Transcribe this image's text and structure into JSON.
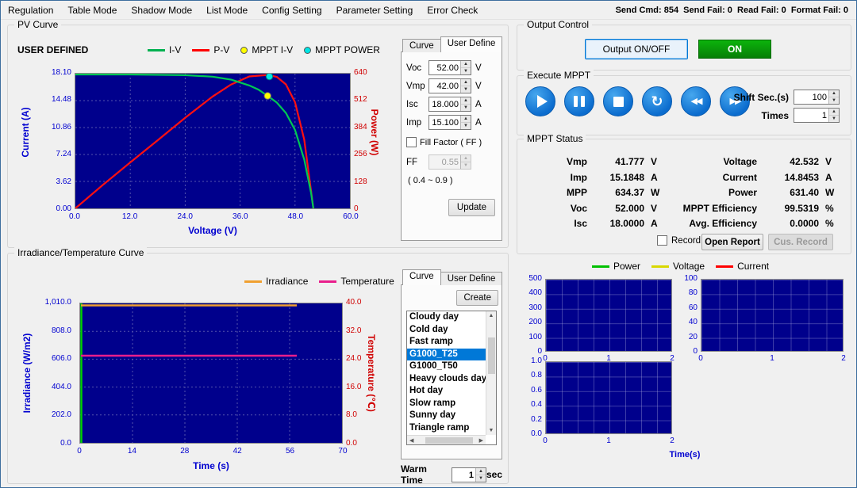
{
  "window": {
    "menu_items": [
      "Regulation",
      "Table Mode",
      "Shadow Mode",
      "List Mode",
      "Config Setting",
      "Parameter Setting",
      "Error Check"
    ],
    "comm_status": "Send Cmd: 854  Send Fail: 0  Read Fail: 0  Format Fail: 0"
  },
  "pv_curve": {
    "title": "PV Curve",
    "mode_label": "USER DEFINED",
    "legend": [
      {
        "label": "I-V",
        "color": "#00b050",
        "marker": "line"
      },
      {
        "label": "P-V",
        "color": "#ff0000",
        "marker": "line"
      },
      {
        "label": "MPPT I-V",
        "color": "#ffff00",
        "marker": "dot"
      },
      {
        "label": "MPPT POWER",
        "color": "#00e5e5",
        "marker": "dot"
      }
    ],
    "y_left": {
      "label": "Current (A)",
      "ticks": [
        "18.10",
        "14.48",
        "10.86",
        "7.24",
        "3.62",
        "0.00"
      ]
    },
    "y_right": {
      "label": "Power (W)",
      "ticks": [
        "640",
        "512",
        "384",
        "256",
        "128",
        "0"
      ]
    },
    "x": {
      "label": "Voltage (V)",
      "ticks": [
        "0.0",
        "12.0",
        "24.0",
        "36.0",
        "48.0",
        "60.0"
      ]
    }
  },
  "pv_params": {
    "tabs": [
      "Curve",
      "User Define"
    ],
    "fields": [
      {
        "label": "Voc",
        "value": "52.00",
        "unit": "V"
      },
      {
        "label": "Vmp",
        "value": "42.00",
        "unit": "V"
      },
      {
        "label": "Isc",
        "value": "18.000",
        "unit": "A"
      },
      {
        "label": "Imp",
        "value": "15.100",
        "unit": "A"
      }
    ],
    "fill_factor_label": "Fill Factor ( FF )",
    "ff_label": "FF",
    "ff_value": "0.55",
    "ff_range": "( 0.4 ~ 0.9 )",
    "update_label": "Update"
  },
  "output_control": {
    "title": "Output Control",
    "button_label": "Output ON/OFF",
    "state": "ON"
  },
  "execute_mppt": {
    "title": "Execute MPPT",
    "shift_label": "Shift Sec.(s)",
    "shift_value": "100",
    "times_label": "Times",
    "times_value": "1"
  },
  "mppt_status": {
    "title": "MPPT Status",
    "rows": [
      {
        "l1": "Vmp",
        "v1": "41.777",
        "u1": "V",
        "l2": "Voltage",
        "v2": "42.532",
        "u2": "V"
      },
      {
        "l1": "Imp",
        "v1": "15.1848",
        "u1": "A",
        "l2": "Current",
        "v2": "14.8453",
        "u2": "A"
      },
      {
        "l1": "MPP",
        "v1": "634.37",
        "u1": "W",
        "l2": "Power",
        "v2": "631.40",
        "u2": "W"
      },
      {
        "l1": "Voc",
        "v1": "52.000",
        "u1": "V",
        "l2": "MPPT Efficiency",
        "v2": "99.5319",
        "u2": "%"
      },
      {
        "l1": "Isc",
        "v1": "18.0000",
        "u1": "A",
        "l2": "Avg. Efficiency",
        "v2": "0.0000",
        "u2": "%"
      }
    ],
    "record_label": "Record",
    "open_report_label": "Open Report",
    "cus_record_label": "Cus. Record"
  },
  "irr_curve": {
    "title": "Irradiance/Temperature Curve",
    "legend": [
      {
        "label": "Irradiance",
        "color": "#f0a030"
      },
      {
        "label": "Temperature",
        "color": "#e91e8c"
      }
    ],
    "y_left": {
      "label": "Irradiance (W/m2)",
      "ticks": [
        "1,010.0",
        "808.0",
        "606.0",
        "404.0",
        "202.0",
        "0.0"
      ]
    },
    "y_right": {
      "label": "Temperature (℃)",
      "ticks": [
        "40.0",
        "32.0",
        "24.0",
        "16.0",
        "8.0",
        "0.0"
      ]
    },
    "x": {
      "label": "Time (s)",
      "ticks": [
        "0",
        "14",
        "28",
        "42",
        "56",
        "70"
      ]
    }
  },
  "profile_list": {
    "tabs": [
      "Curve",
      "User Define"
    ],
    "create_label": "Create",
    "items": [
      {
        "label": "Cloudy day",
        "selected": false
      },
      {
        "label": "Cold day",
        "selected": false
      },
      {
        "label": "Fast ramp",
        "selected": false
      },
      {
        "label": "G1000_T25",
        "selected": true
      },
      {
        "label": "G1000_T50",
        "selected": false
      },
      {
        "label": "Heavy clouds day",
        "selected": false
      },
      {
        "label": "Hot day",
        "selected": false
      },
      {
        "label": "Slow ramp",
        "selected": false
      },
      {
        "label": "Sunny day",
        "selected": false
      },
      {
        "label": "Triangle ramp",
        "selected": false
      }
    ],
    "warm_time_label": "Warm Time",
    "warm_time_value": "1",
    "warm_time_unit": "sec"
  },
  "monitor": {
    "legend": [
      {
        "label": "Power",
        "color": "#00c000"
      },
      {
        "label": "Voltage",
        "color": "#d8d800"
      },
      {
        "label": "Current",
        "color": "#ff0000"
      }
    ],
    "charts": [
      {
        "yticks": [
          "500",
          "400",
          "300",
          "200",
          "100",
          "0"
        ],
        "xticks": [
          "0",
          "1",
          "2"
        ],
        "xlabel": ""
      },
      {
        "yticks": [
          "100",
          "80",
          "60",
          "40",
          "20",
          "0"
        ],
        "xticks": [
          "0",
          "1",
          "2"
        ],
        "xlabel": ""
      },
      {
        "yticks": [
          "1.0",
          "0.8",
          "0.6",
          "0.4",
          "0.2",
          "0.0"
        ],
        "xticks": [
          "0",
          "1",
          "2"
        ],
        "xlabel": "Time(s)"
      }
    ]
  }
}
